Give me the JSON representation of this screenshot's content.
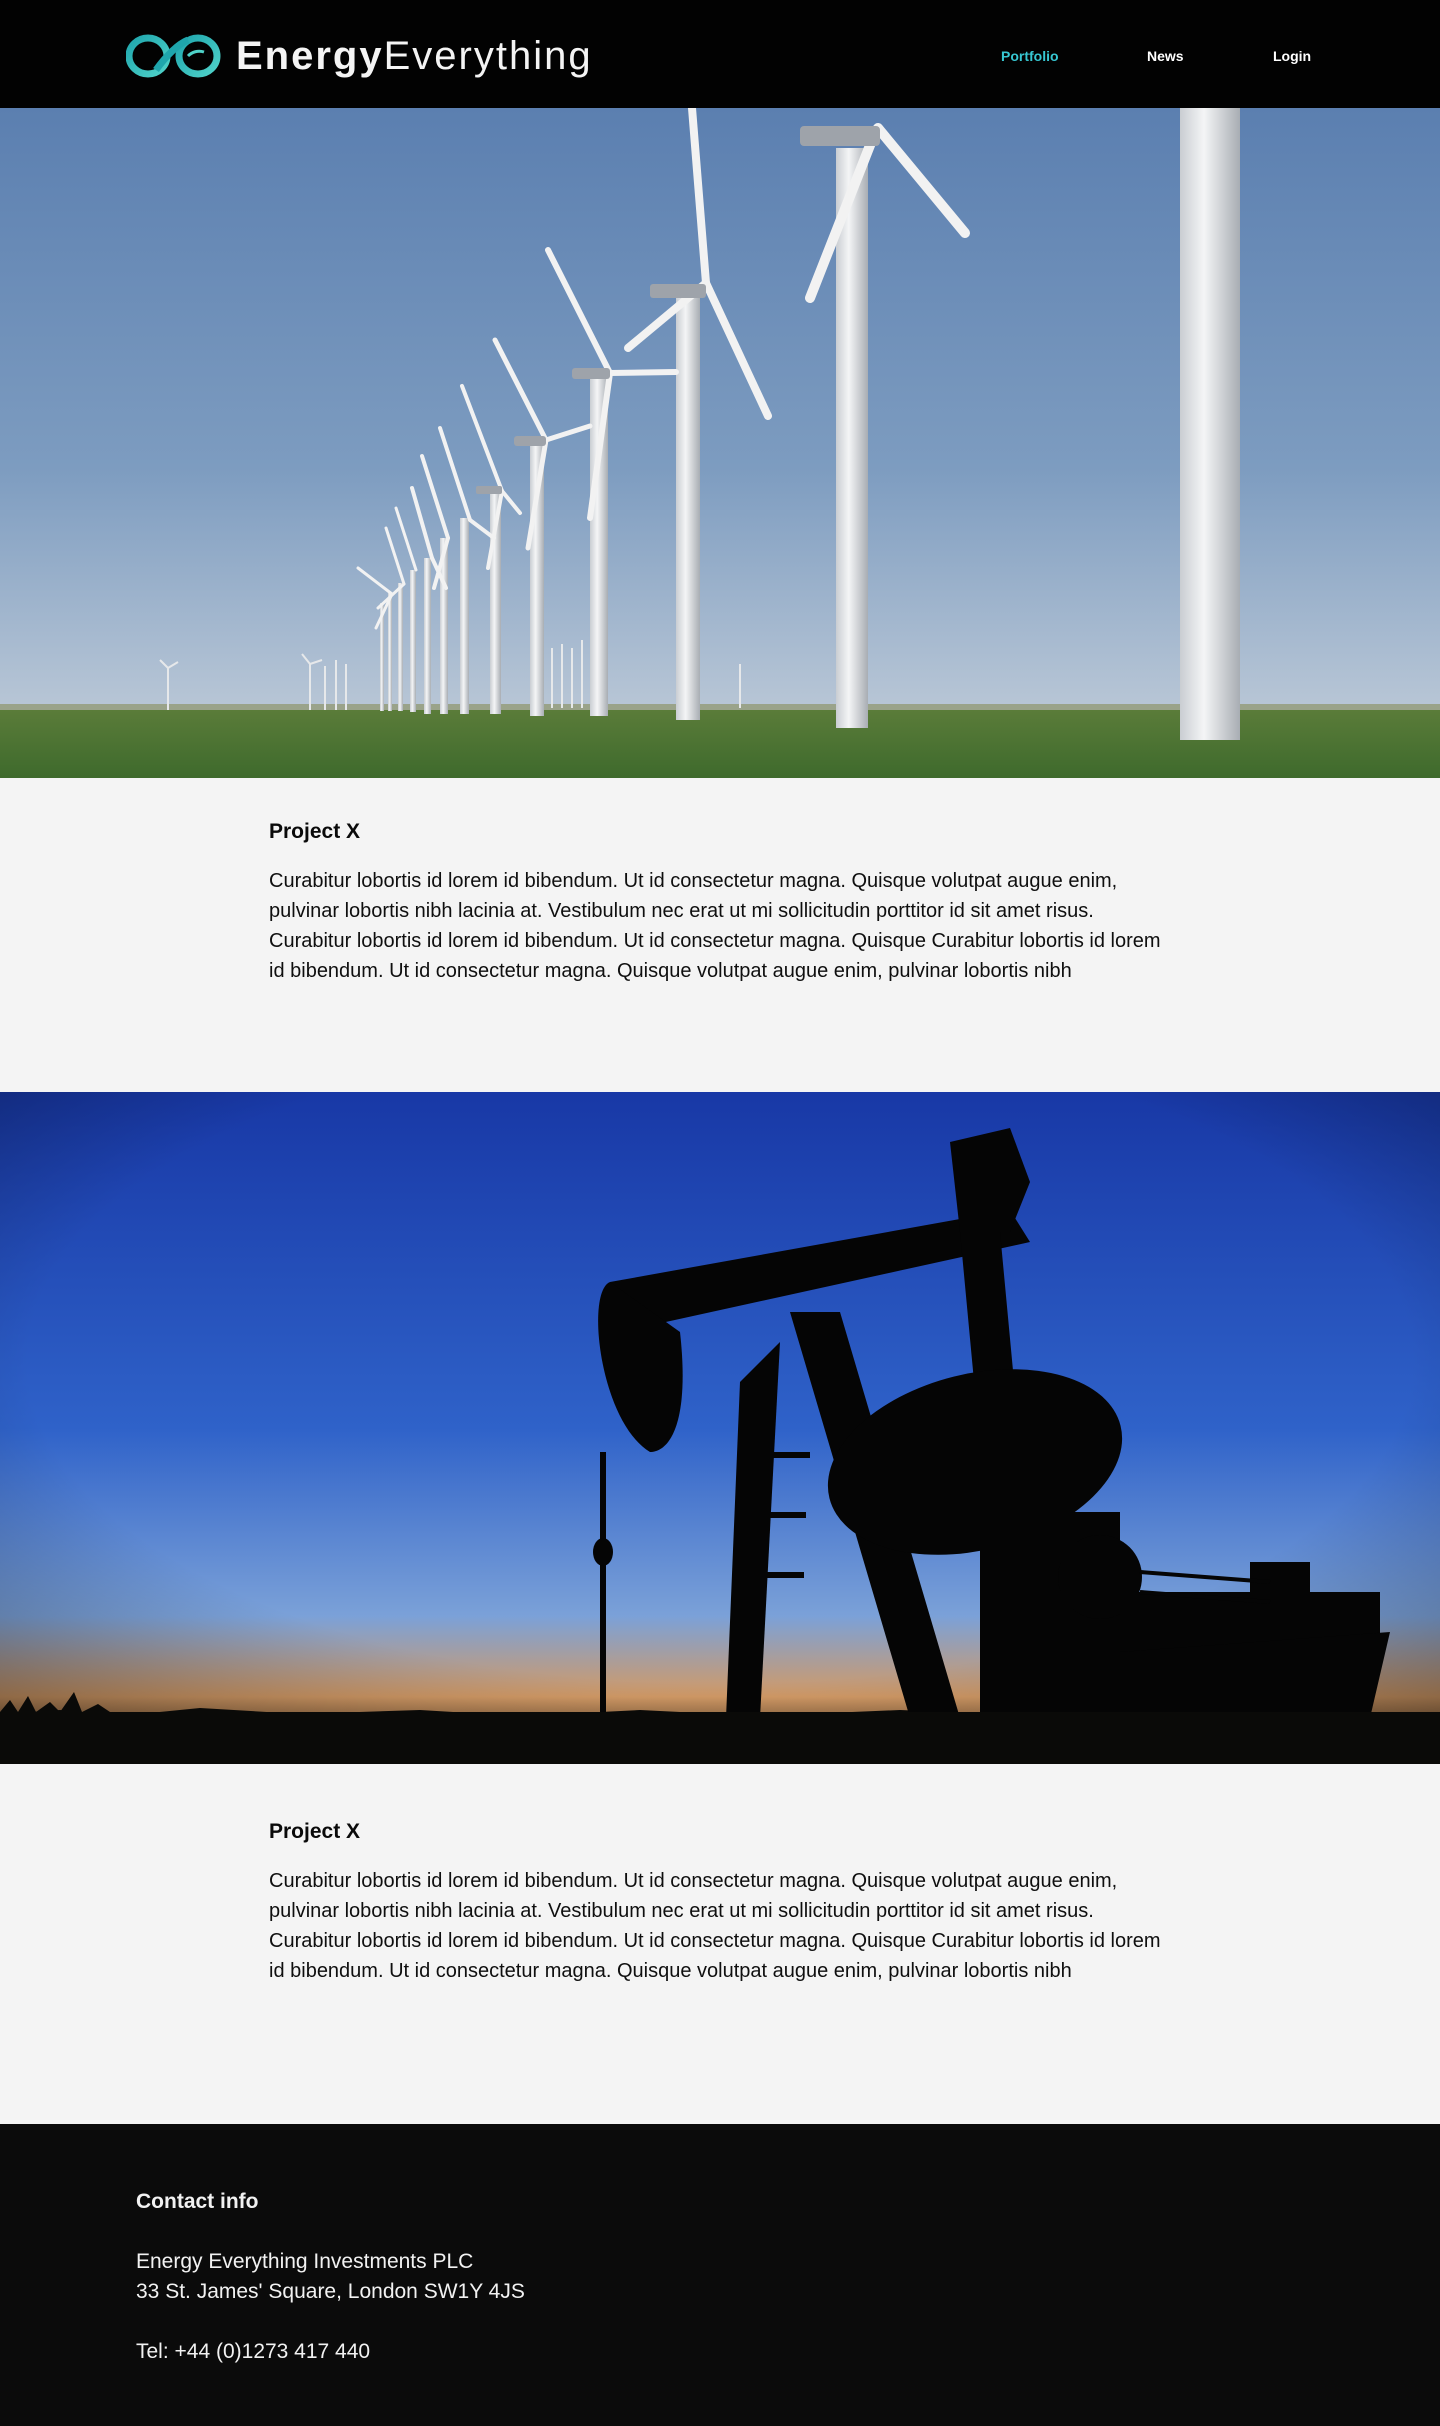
{
  "brand": {
    "name_bold": "Energy",
    "name_light": "Everything",
    "logo_colors": [
      "#1fa6ad",
      "#4fd2c9"
    ]
  },
  "nav": {
    "items": [
      {
        "label": "Portfolio",
        "active": true
      },
      {
        "label": "News",
        "active": false
      },
      {
        "label": "Login",
        "active": false
      }
    ],
    "active_color": "#37c7d2"
  },
  "projects": [
    {
      "image": "wind-turbines-photo",
      "title": "Project X",
      "body": "Curabitur lobortis id lorem id bibendum. Ut id consectetur magna. Quisque volutpat augue enim, pulvinar lobortis nibh lacinia at. Vestibulum nec erat ut mi sollicitudin porttitor id sit amet risus. Curabitur lobortis id lorem id bibendum. Ut id consectetur magna. Quisque Curabitur lobortis id lorem id bibendum. Ut id consectetur magna. Quisque volutpat augue enim, pulvinar lobortis nibh"
    },
    {
      "image": "oil-pumpjack-photo",
      "title": "Project X",
      "body": "Curabitur lobortis id lorem id bibendum. Ut id consectetur magna. Quisque volutpat augue enim, pulvinar lobortis nibh lacinia at. Vestibulum nec erat ut mi sollicitudin porttitor id sit amet risus. Curabitur lobortis id lorem id bibendum. Ut id consectetur magna. Quisque Curabitur lobortis id lorem id bibendum. Ut id consectetur magna. Quisque volutpat augue enim, pulvinar lobortis nibh"
    }
  ],
  "footer": {
    "title": "Contact info",
    "company": "Energy Everything Investments PLC",
    "address": "33 St. James' Square, London SW1Y 4JS",
    "phone": "Tel: +44 (0)1273 417 440"
  }
}
